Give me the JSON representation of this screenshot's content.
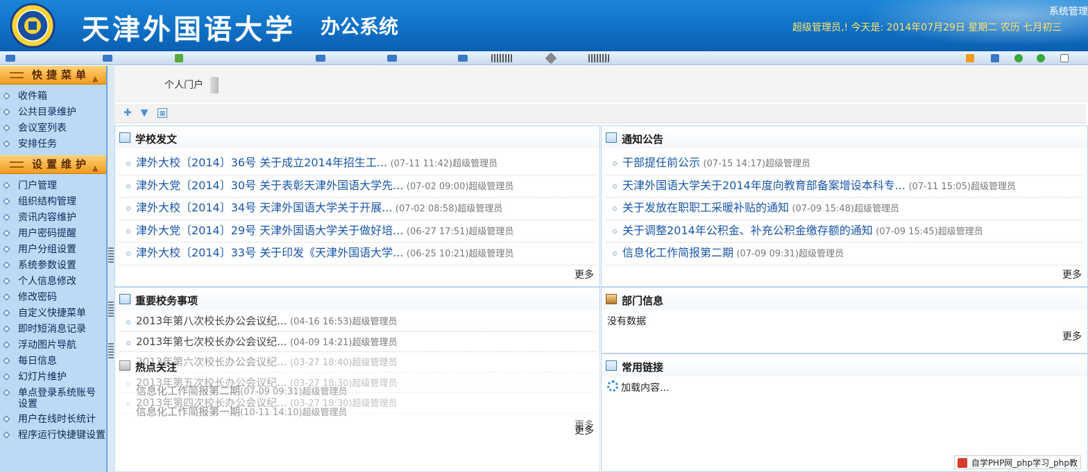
{
  "header": {
    "university": "天津外国语大学",
    "system": "办公系统",
    "right_link": "系统管理",
    "greeting": "超级管理员,! 今天是: 2014年07月29日  星期二    农历 七月初三"
  },
  "sidebar": {
    "sections": [
      {
        "title": "快捷菜单",
        "items": [
          "收件箱",
          "公共目录维护",
          "会议室列表",
          "安排任务"
        ]
      },
      {
        "title": "设置维护",
        "items": [
          "门户管理",
          "组织结构管理",
          "资讯内容维护",
          "用户密码提醒",
          "用户分组设置",
          "系统参数设置",
          "个人信息修改",
          "修改密码",
          "自定义快捷菜单",
          "即时短消息记录",
          "浮动图片导航",
          "每日信息",
          "幻灯片维护",
          "单点登录系统账号设置",
          "用户在线时长统计",
          "程序运行快捷键设置"
        ]
      }
    ]
  },
  "main": {
    "tab": "个人门户",
    "more_label": "更多",
    "panels": {
      "school_docs": {
        "title": "学校发文",
        "rows": [
          {
            "title": "津外大校〔2014〕36号 关于成立2014年招生工...",
            "meta": "(07-11 11:42)超级管理员"
          },
          {
            "title": "津外大党〔2014〕30号 关于表彰天津外国语大学先...",
            "meta": "(07-02 09:00)超级管理员"
          },
          {
            "title": "津外大校〔2014〕34号 天津外国语大学关于开展...",
            "meta": "(07-02 08:58)超级管理员"
          },
          {
            "title": "津外大党〔2014〕29号 天津外国语大学关于做好培...",
            "meta": "(06-27 17:51)超级管理员"
          },
          {
            "title": "津外大校〔2014〕33号 关于印发《天津外国语大学...",
            "meta": "(06-25 10:21)超级管理员"
          }
        ]
      },
      "notices": {
        "title": "通知公告",
        "rows": [
          {
            "title": "干部提任前公示",
            "meta": "(07-15 14:17)超级管理员"
          },
          {
            "title": "天津外国语大学关于2014年度向教育部备案增设本科专...",
            "meta": "(07-11 15:05)超级管理员"
          },
          {
            "title": "关于发放在职职工采暖补贴的通知",
            "meta": "(07-09 15:48)超级管理员"
          },
          {
            "title": "关于调整2014年公积金、补充公积金缴存额的通知",
            "meta": "(07-09 15:45)超级管理员"
          },
          {
            "title": "信息化工作简报第二期",
            "meta": "(07-09 09:31)超级管理员"
          }
        ]
      },
      "important": {
        "title": "重要校务事项",
        "rows": [
          {
            "title": "2013年第八次校长办公会议纪...",
            "meta": "(04-16 16:53)超级管理员"
          },
          {
            "title": "2013年第七次校长办公会议纪...",
            "meta": "(04-09 14:21)超级管理员"
          },
          {
            "title": "2013年第六次校长办公会议纪...",
            "meta": "(03-27 18:40)超级管理员"
          },
          {
            "title": "2013年第五次校长办公会议纪...",
            "meta": "(03-27 18:30)超级管理员"
          },
          {
            "title": "2013年第四次校长办公会议纪...",
            "meta": "(03-27 18:30)超级管理员"
          }
        ]
      },
      "dept": {
        "title": "部门信息",
        "empty": "没有数据"
      },
      "hot": {
        "title": "热点关注",
        "rows": [
          {
            "title": "信息化工作简报第二期",
            "meta": "(07-09 09:31)超级管理员"
          },
          {
            "title": "信息化工作简报第一期",
            "meta": "(10-11 14:10)超级管理员"
          }
        ]
      },
      "links": {
        "title": "常用链接",
        "loading": "加载内容..."
      }
    }
  },
  "watermark": "自学PHP网_php学习_php教"
}
